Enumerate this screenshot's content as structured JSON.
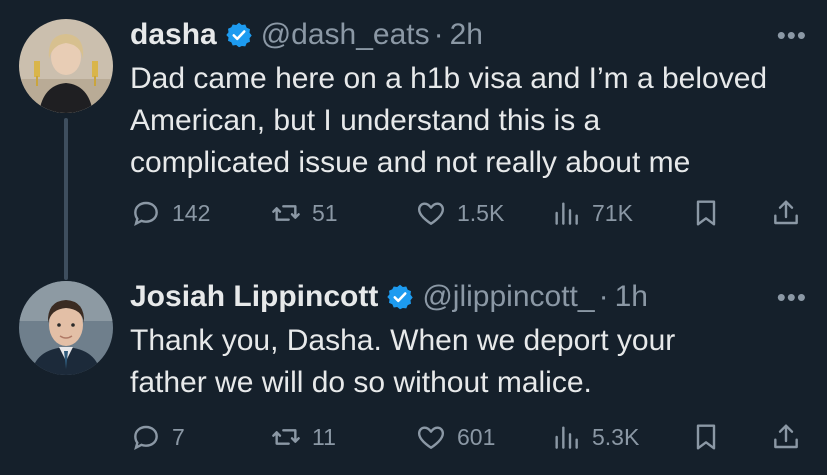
{
  "tweets": [
    {
      "name": "dasha",
      "handle": "@dash_eats",
      "separator": "·",
      "time": "2h",
      "more_label": "•••",
      "lines": [
        "Dad came here on a h1b visa and I’m a beloved",
        "American, but I understand this is a",
        "complicated issue and not really about me"
      ],
      "stats": {
        "replies": "142",
        "reposts": "51",
        "likes": "1.5K",
        "views": "71K"
      },
      "icons": {
        "verified": "verified-badge-icon",
        "reply": "reply-icon",
        "repost": "repost-icon",
        "like": "heart-icon",
        "views": "views-icon",
        "bookmark": "bookmark-icon",
        "share": "share-icon"
      }
    },
    {
      "name": "Josiah Lippincott",
      "handle": "@jlippincott_",
      "separator": "·",
      "time": "1h",
      "more_label": "•••",
      "lines": [
        "Thank you, Dasha. When we deport your",
        "father we will do so without malice."
      ],
      "stats": {
        "replies": "7",
        "reposts": "11",
        "likes": "601",
        "views": "5.3K"
      },
      "icons": {
        "verified": "verified-badge-icon",
        "reply": "reply-icon",
        "repost": "repost-icon",
        "like": "heart-icon",
        "views": "views-icon",
        "bookmark": "bookmark-icon",
        "share": "share-icon"
      }
    }
  ],
  "colors": {
    "background": "#15202b",
    "text": "#e7e9ea",
    "secondary_text": "#8b98a5",
    "verified": "#1d9bf0"
  }
}
